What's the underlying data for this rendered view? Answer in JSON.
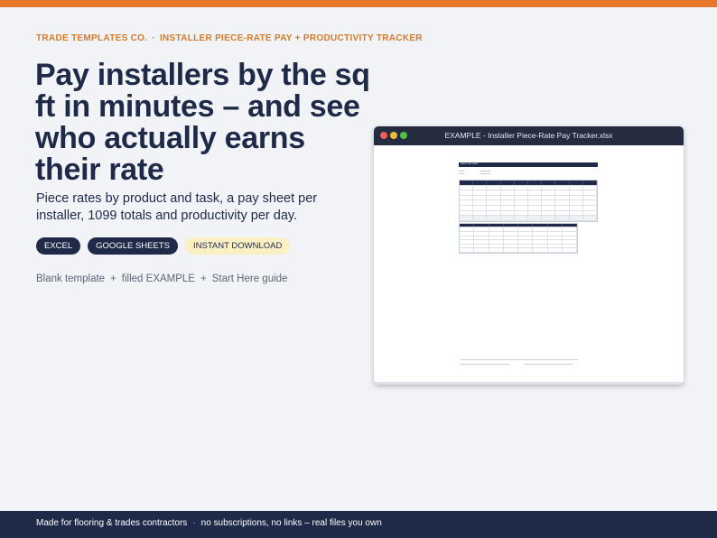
{
  "colors": {
    "accent": "#e6782a",
    "navy": "#1e2a48",
    "chip_highlight": "#fbf0c4",
    "background": "#f1f3f6"
  },
  "eyebrow": {
    "brand": "TRADE TEMPLATES CO.",
    "separator": "·",
    "product": "INSTALLER PIECE-RATE PAY + PRODUCTIVITY TRACKER"
  },
  "headline": "Pay installers by the sq ft in minutes – and see who actually earns their rate",
  "subhead": "Piece rates by product and task, a pay sheet per installer, 1099 totals and productivity per day.",
  "chips": [
    "EXCEL",
    "GOOGLE SHEETS",
    "INSTANT DOWNLOAD"
  ],
  "includes": {
    "items": [
      "Blank template",
      "filled EXAMPLE",
      "Start Here guide"
    ],
    "joiner": "+"
  },
  "preview_window": {
    "title": "EXAMPLE - Installer Piece-Rate Pay Tracker.xlsx",
    "controls": [
      "close-icon",
      "minimize-icon",
      "maximize-icon"
    ],
    "sheet": {
      "header": "WEEKLY PAY SHEET",
      "fields": [
        "Installer",
        "Week Ending"
      ]
    }
  },
  "footer": {
    "left": "Made for flooring & trades contractors",
    "separator": "·",
    "right": "no subscriptions, no links – real files you own"
  }
}
